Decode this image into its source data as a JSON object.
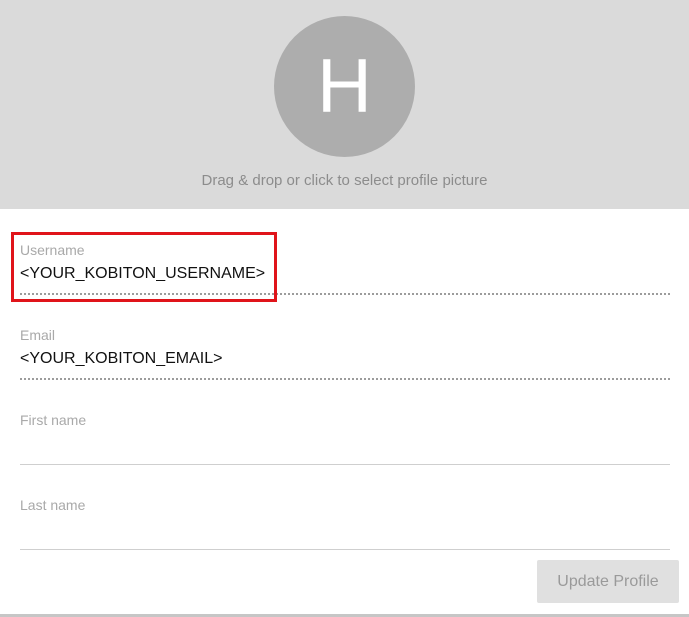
{
  "avatar": {
    "initial": "H"
  },
  "profile_picture": {
    "hint": "Drag & drop or click to select profile picture"
  },
  "fields": {
    "username": {
      "label": "Username",
      "value": "<YOUR_KOBITON_USERNAME>"
    },
    "email": {
      "label": "Email",
      "value": "<YOUR_KOBITON_EMAIL>"
    },
    "first_name": {
      "label": "First name",
      "value": ""
    },
    "last_name": {
      "label": "Last name",
      "value": ""
    }
  },
  "actions": {
    "update_label": "Update Profile"
  },
  "colors": {
    "header_background": "#dadada",
    "avatar_background": "#adadad",
    "highlight": "#e0141a",
    "button_background": "#e0e0e0"
  }
}
